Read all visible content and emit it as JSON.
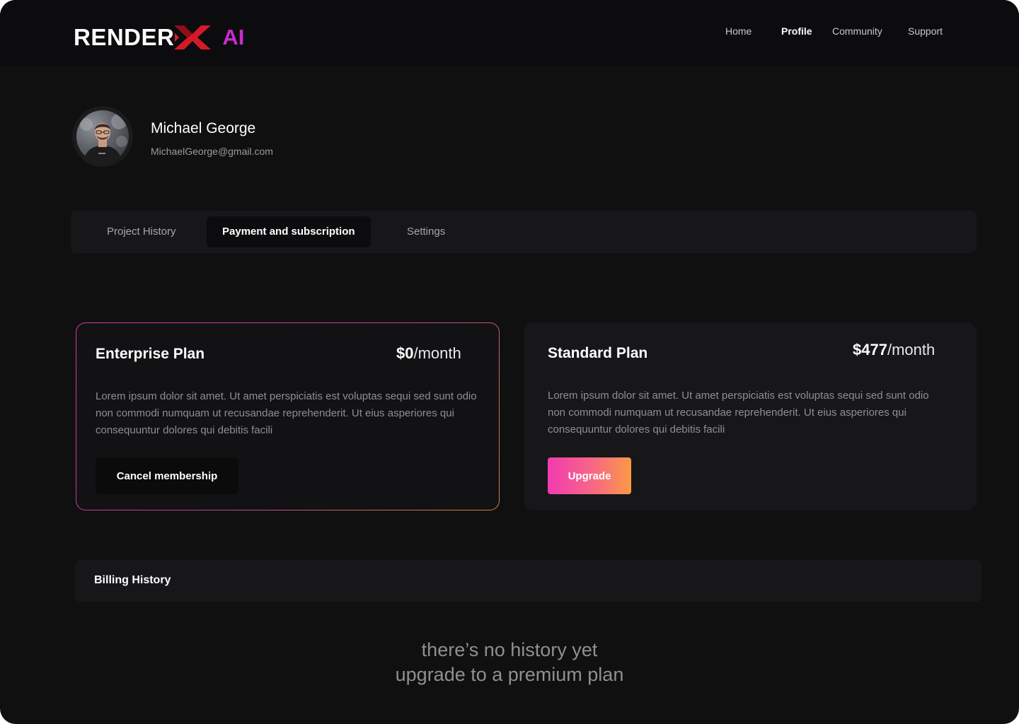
{
  "brand": {
    "name": "RENDER",
    "x_mark": "X",
    "suffix": "AI",
    "colors": {
      "x_mark": "#e11d2a",
      "suffix": "#c72ccf"
    }
  },
  "nav": {
    "items": [
      {
        "label": "Home",
        "active": false
      },
      {
        "label": "Profile",
        "active": true
      },
      {
        "label": "Community",
        "active": false
      },
      {
        "label": "Support",
        "active": false
      }
    ]
  },
  "user": {
    "name": "Michael George",
    "email": "MichaelGeorge@gmail.com",
    "avatar_icon": "user-avatar-photo"
  },
  "tabs": [
    {
      "label": "Project History",
      "active": false
    },
    {
      "label": "Payment and subscription",
      "active": true
    },
    {
      "label": "Settings",
      "active": false
    }
  ],
  "plans": {
    "enterprise": {
      "title": "Enterprise Plan",
      "price": "$0",
      "period": "/month",
      "description": "Lorem ipsum dolor sit amet. Ut amet perspiciatis est voluptas sequi sed sunt odio non commodi numquam ut recusandae reprehenderit. Ut eius asperiores qui consequuntur dolores qui debitis facili",
      "button_label": "Cancel membership",
      "current": true
    },
    "standard": {
      "title": "Standard Plan",
      "price": "$477",
      "period": "/month",
      "description": "Lorem ipsum dolor sit amet. Ut amet perspiciatis est voluptas sequi sed sunt odio non commodi numquam ut recusandae reprehenderit. Ut eius asperiores qui consequuntur dolores qui debitis facili",
      "button_label": "Upgrade"
    }
  },
  "billing": {
    "title": "Billing History",
    "empty_line1": "there’s no history yet",
    "empty_line2": "upgrade to a premium plan"
  },
  "colors": {
    "background": "#101010",
    "panel": "#17171a",
    "accent_gradient_start": "#f23ab2",
    "accent_gradient_end": "#fb9a44"
  }
}
